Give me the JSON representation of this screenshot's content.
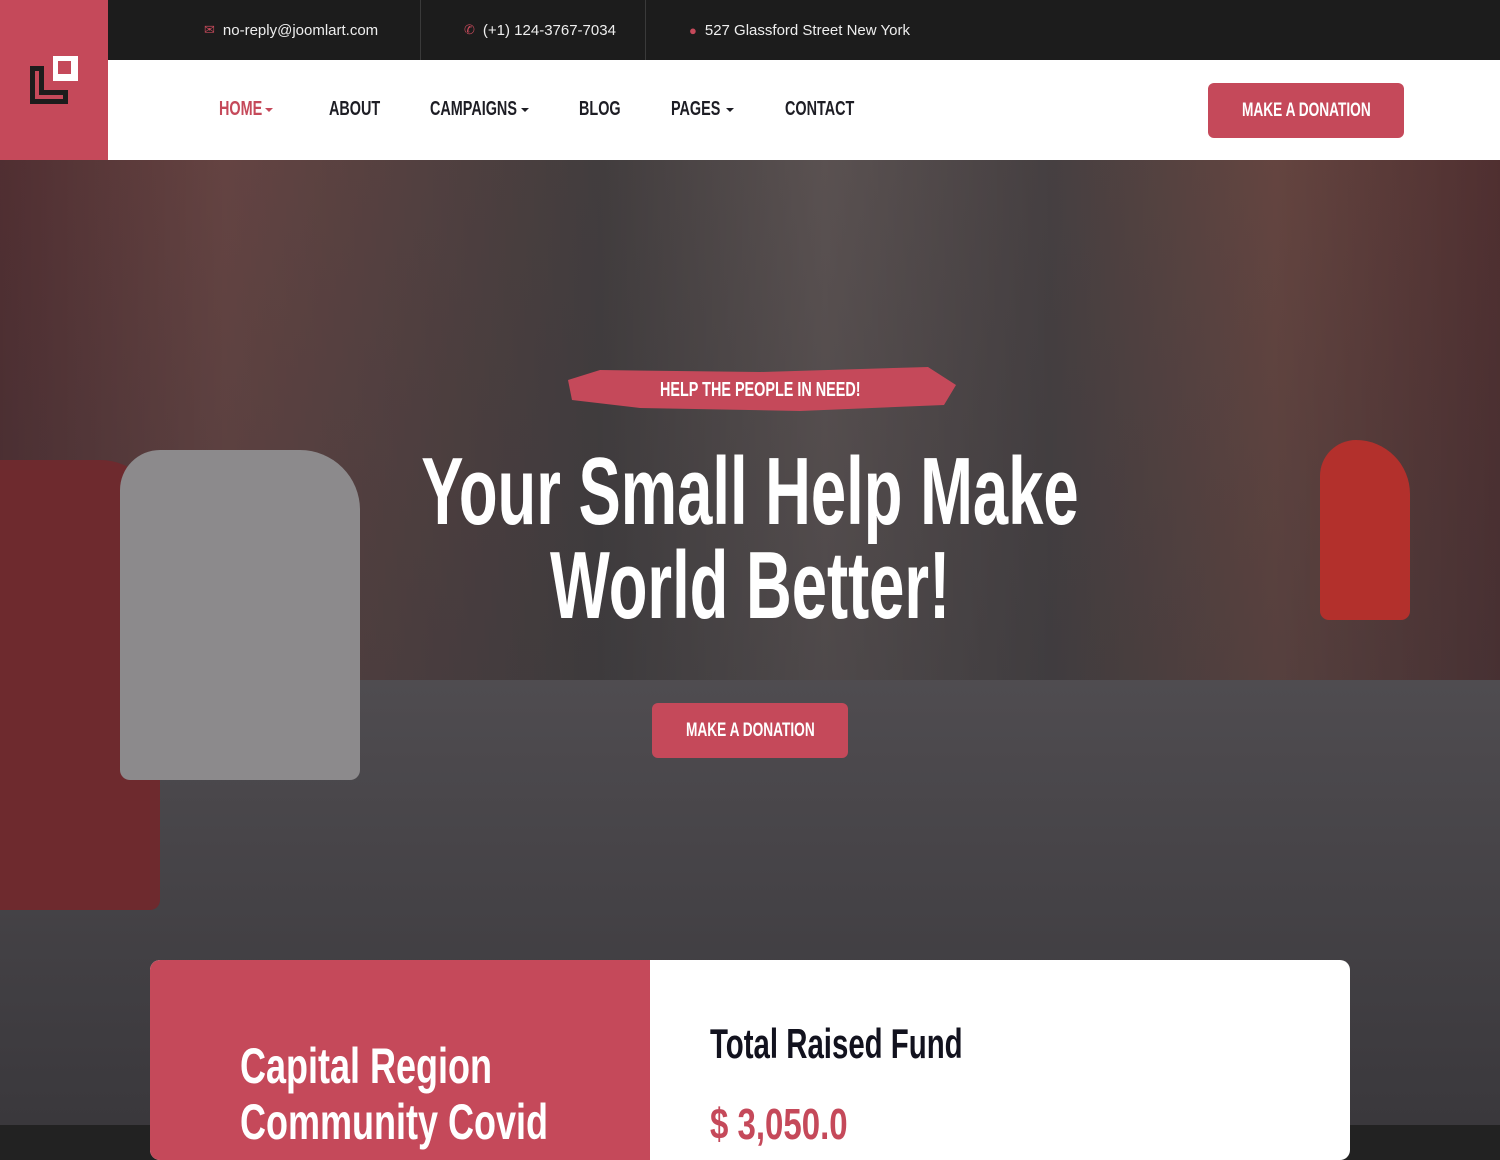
{
  "topbar": {
    "email": "no-reply@joomlart.com",
    "phone": "(+1) 124-3767-7034",
    "address": "527 Glassford Street New York"
  },
  "nav": {
    "items": [
      {
        "label": "HOME",
        "active": true,
        "dropdown": true
      },
      {
        "label": "ABOUT"
      },
      {
        "label": "CAMPAIGNS",
        "dropdown": true
      },
      {
        "label": "BLOG"
      },
      {
        "label": "PAGES",
        "dropdown": true
      },
      {
        "label": "CONTACT"
      }
    ],
    "cta": "MAKE A DONATION"
  },
  "hero": {
    "tagline": "HELP THE PEOPLE IN NEED!",
    "title_line1": "Your Small Help Make",
    "title_line2": "World Better!",
    "cta": "MAKE A DONATION"
  },
  "campaign": {
    "title_line1": "Capital Region",
    "title_line2": "Community Covid",
    "fund_label": "Total Raised Fund",
    "fund_value": "$ 3,050.0"
  },
  "colors": {
    "accent": "#c5495a",
    "dark": "#1c1c1c"
  }
}
